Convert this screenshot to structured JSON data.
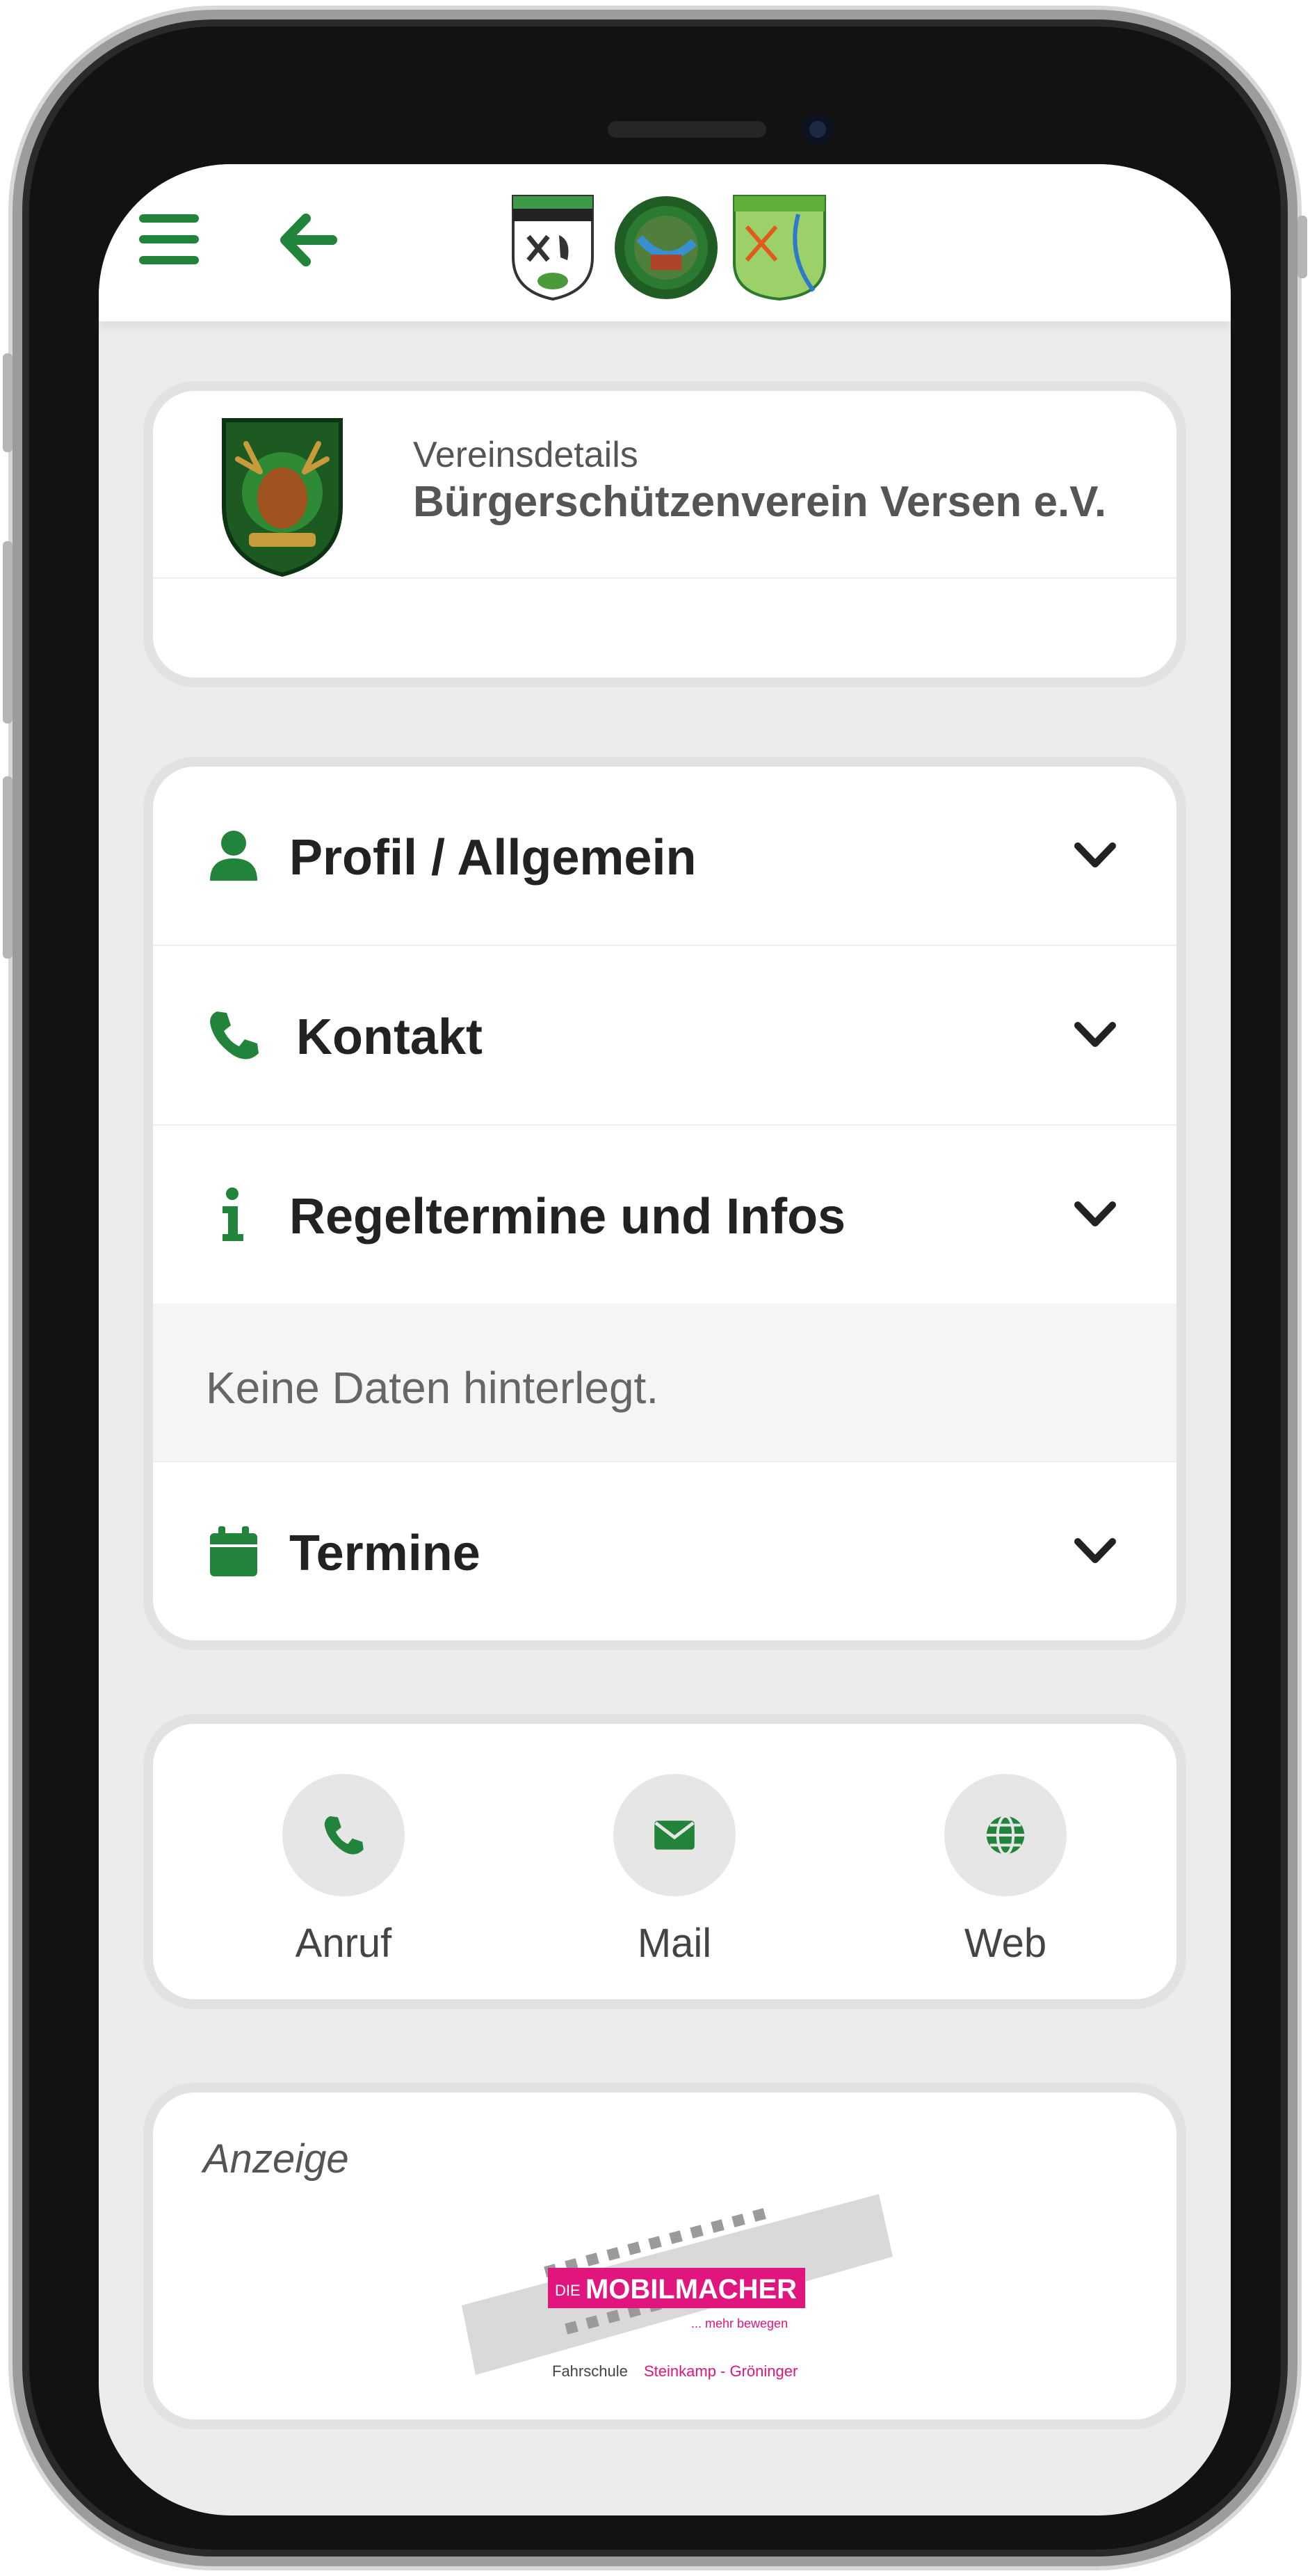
{
  "header": {
    "menu_icon": "hamburger-menu-icon",
    "back_icon": "arrow-left-icon",
    "logos": [
      "club-crest-logo",
      "round-emblem-logo",
      "village-map-logo"
    ]
  },
  "club": {
    "kicker": "Vereinsdetails",
    "name": "Bürgerschützenverein Versen e.V."
  },
  "accordion": {
    "items": [
      {
        "label": "Profil / Allgemein",
        "icon": "user-icon",
        "expanded": false
      },
      {
        "label": "Kontakt",
        "icon": "phone-icon",
        "expanded": false
      },
      {
        "label": "Regeltermine und Infos",
        "icon": "info-icon",
        "expanded": true,
        "body": "Keine Daten hinterlegt."
      },
      {
        "label": "Termine",
        "icon": "calendar-icon",
        "expanded": false
      }
    ]
  },
  "actions": [
    {
      "label": "Anruf",
      "icon": "phone-icon"
    },
    {
      "label": "Mail",
      "icon": "envelope-icon"
    },
    {
      "label": "Web",
      "icon": "globe-icon"
    }
  ],
  "ad": {
    "label": "Anzeige",
    "banner": {
      "brand_prefix": "DIE",
      "brand": "MOBILMACHER",
      "tagline": "... mehr bewegen",
      "footer_prefix": "Fahrschule",
      "footer_highlight": "Steinkamp - Gröninger"
    }
  },
  "colors": {
    "accent_green": "#22833a",
    "brand_magenta": "#e0157e",
    "background": "#ececec"
  }
}
